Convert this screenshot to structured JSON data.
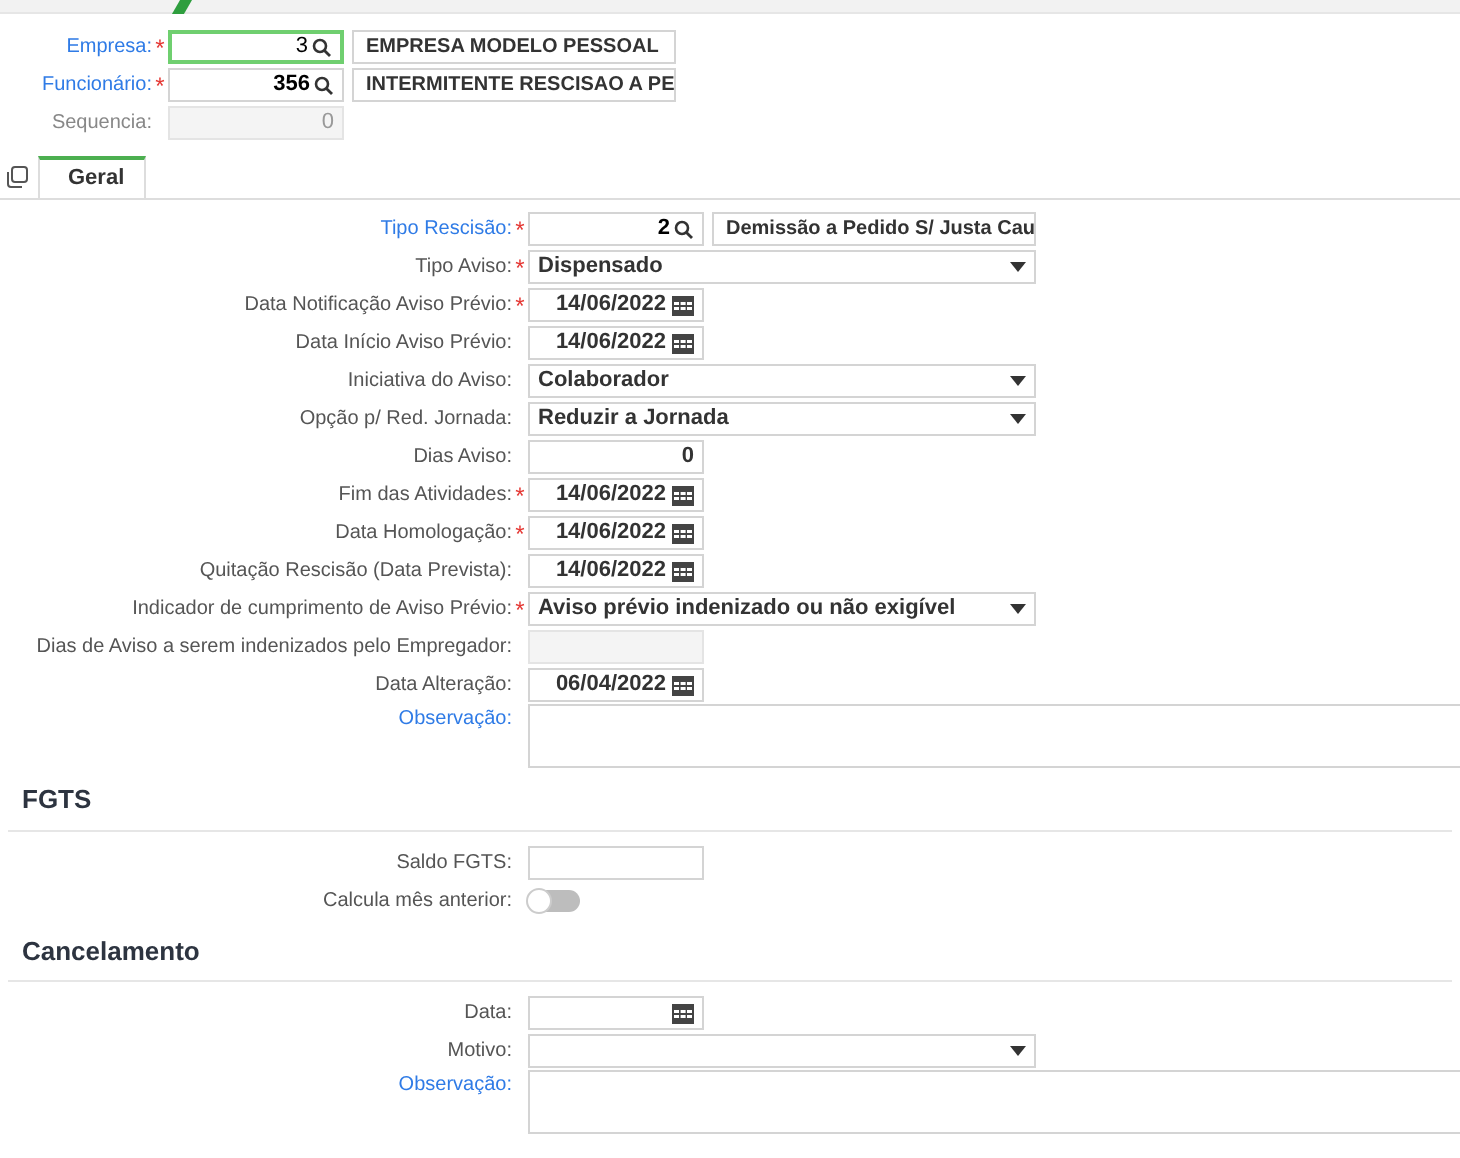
{
  "header": {
    "fields": [
      {
        "label": "Empresa:",
        "required_mark": "*",
        "link": true,
        "kind": "lookup",
        "value": "3",
        "description": "EMPRESA MODELO PESSOAL",
        "focused": true
      },
      {
        "label": "Funcionário:",
        "required_mark": "*",
        "link": true,
        "kind": "lookup",
        "value": "356",
        "description": "INTERMITENTE RESCISAO A PE",
        "focused": false
      },
      {
        "label": "Sequencia:",
        "link": false,
        "kind": "disabled",
        "value": "0"
      }
    ]
  },
  "tabs": [
    {
      "label": "Geral",
      "selected": true
    }
  ],
  "geral": {
    "fields": [
      {
        "label": "Tipo Rescisão:",
        "required_mark": "*",
        "link": true,
        "kind": "lookup",
        "value": "2",
        "description": "Demissão a Pedido S/ Justa Cau"
      },
      {
        "label": "Tipo Aviso:",
        "required_mark": "*",
        "link": false,
        "kind": "select",
        "value": "Dispensado"
      },
      {
        "label": "Data Notificação Aviso Prévio:",
        "required_mark": "*",
        "link": false,
        "kind": "date",
        "value": "14/06/2022"
      },
      {
        "label": "Data Início Aviso Prévio:",
        "link": false,
        "kind": "date",
        "value": "14/06/2022"
      },
      {
        "label": "Iniciativa do Aviso:",
        "link": false,
        "kind": "select",
        "value": "Colaborador"
      },
      {
        "label": "Opção p/ Red. Jornada:",
        "link": false,
        "kind": "select",
        "value": "Reduzir a Jornada"
      },
      {
        "label": "Dias Aviso:",
        "link": false,
        "kind": "number",
        "value": "0"
      },
      {
        "label": "Fim das Atividades:",
        "required_mark": "*",
        "link": false,
        "kind": "date",
        "value": "14/06/2022"
      },
      {
        "label": "Data Homologação:",
        "required_mark": "*",
        "link": false,
        "kind": "date",
        "value": "14/06/2022"
      },
      {
        "label": "Quitação Rescisão (Data Prevista):",
        "link": false,
        "kind": "date",
        "value": "14/06/2022"
      },
      {
        "label": "Indicador de cumprimento de Aviso Prévio:",
        "required_mark": "*",
        "link": false,
        "kind": "select",
        "value": "Aviso prévio indenizado ou não exigível"
      },
      {
        "label": "Dias de Aviso a serem indenizados pelo Empregador:",
        "link": false,
        "kind": "disabled"
      },
      {
        "label": "Data Alteração:",
        "link": false,
        "kind": "date",
        "value": "06/04/2022"
      },
      {
        "label": "Observação:",
        "link": true,
        "kind": "textarea"
      }
    ]
  },
  "sections": [
    {
      "title": "FGTS",
      "fields": [
        {
          "label": "Saldo FGTS:",
          "link": false,
          "kind": "text"
        },
        {
          "label": "Calcula mês anterior:",
          "link": false,
          "kind": "toggle",
          "on": false
        }
      ]
    },
    {
      "title": "Cancelamento",
      "fields": [
        {
          "label": "Data:",
          "link": false,
          "kind": "date"
        },
        {
          "label": "Motivo:",
          "link": false,
          "kind": "select"
        },
        {
          "label": "Observação:",
          "link": true,
          "kind": "textarea"
        }
      ]
    }
  ]
}
